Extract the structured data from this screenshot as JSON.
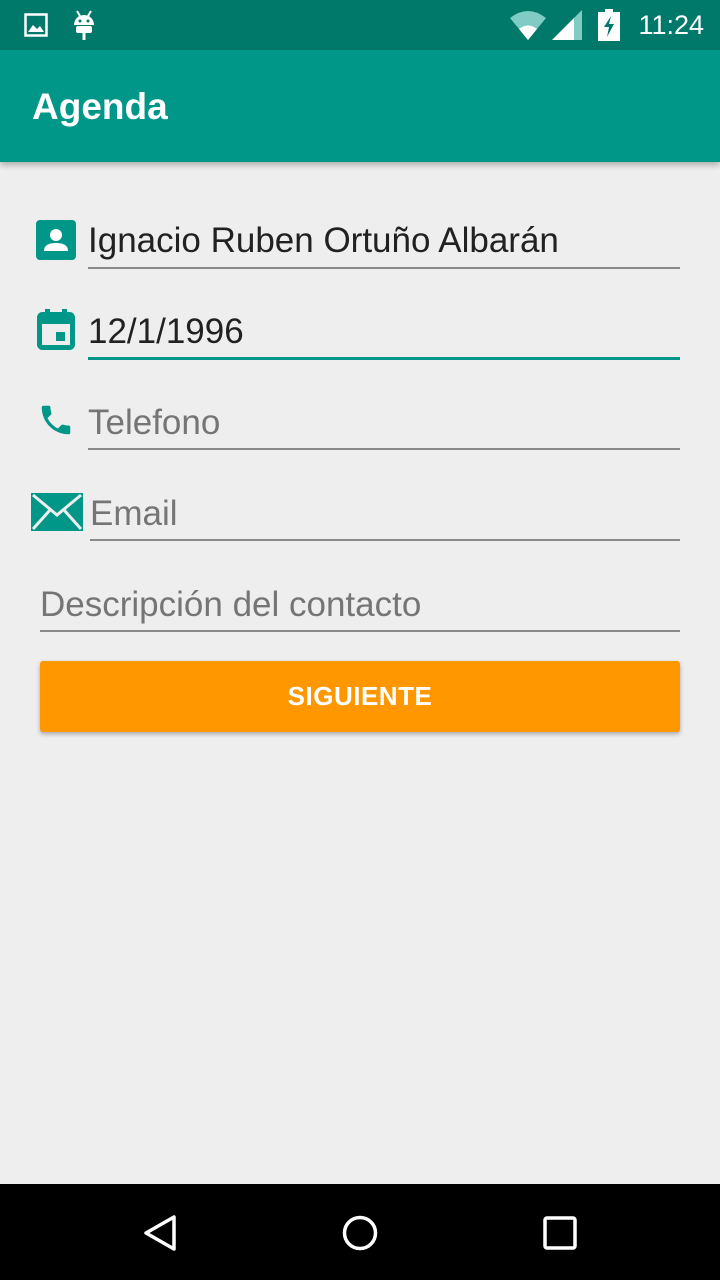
{
  "status_bar": {
    "time": "11:24",
    "icons": [
      "image-icon",
      "android-icon",
      "wifi-icon",
      "signal-icon",
      "battery-charging-icon"
    ]
  },
  "app_bar": {
    "title": "Agenda"
  },
  "form": {
    "name": {
      "value": "Ignacio Ruben Ortuño Albarán",
      "icon": "person-icon"
    },
    "date": {
      "value": "12/1/1996",
      "icon": "calendar-icon"
    },
    "phone": {
      "placeholder": "Telefono",
      "icon": "phone-icon"
    },
    "email": {
      "placeholder": "Email",
      "icon": "mail-icon"
    },
    "description": {
      "placeholder": "Descripción del contacto"
    }
  },
  "button": {
    "label": "SIGUIENTE"
  },
  "nav_bar": {
    "icons": [
      "back-icon",
      "home-icon",
      "recents-icon"
    ]
  },
  "colors": {
    "status_bar": "#00796b",
    "app_bar": "#009688",
    "accent": "#009688",
    "button": "#ff9800",
    "background": "#eeeeee"
  }
}
